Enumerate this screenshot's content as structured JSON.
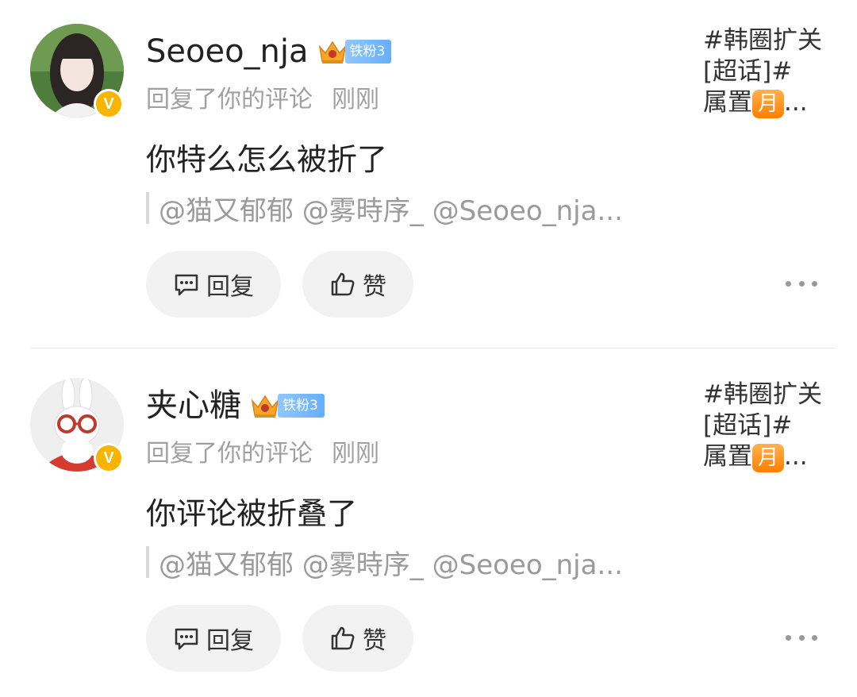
{
  "comments": [
    {
      "username": "Seoeo_nja",
      "fan_badge": "铁粉3",
      "action": "回复了你的评论",
      "time": "刚刚",
      "text": "你特么怎么被折了",
      "quote": "@猫又郁郁 @雾時序_ @Seoeo_nja...",
      "reply_label": "回复",
      "like_label": "赞",
      "topic_line1": "#韩圈扩关",
      "topic_line2": "[超话]#",
      "topic_line3": "属置",
      "topic_badge": "月",
      "topic_ellipsis": "..."
    },
    {
      "username": "夹心糖",
      "fan_badge": "铁粉3",
      "action": "回复了你的评论",
      "time": "刚刚",
      "text": "你评论被折叠了",
      "quote": "@猫又郁郁 @雾時序_ @Seoeo_nja...",
      "reply_label": "回复",
      "like_label": "赞",
      "topic_line1": "#韩圈扩关",
      "topic_line2": "[超话]#",
      "topic_line3": "属置",
      "topic_badge": "月",
      "topic_ellipsis": "..."
    }
  ],
  "verified_badge": "V",
  "colors": {
    "verified": "#f7b500",
    "fan_badge": "#66aefc",
    "month_badge": "#ff8a00",
    "meta_text": "#a0a0a0"
  },
  "icons": {
    "reply": "comment-icon",
    "like": "thumbs-up-icon",
    "more": "more-dots-icon",
    "crown": "crown-icon"
  }
}
